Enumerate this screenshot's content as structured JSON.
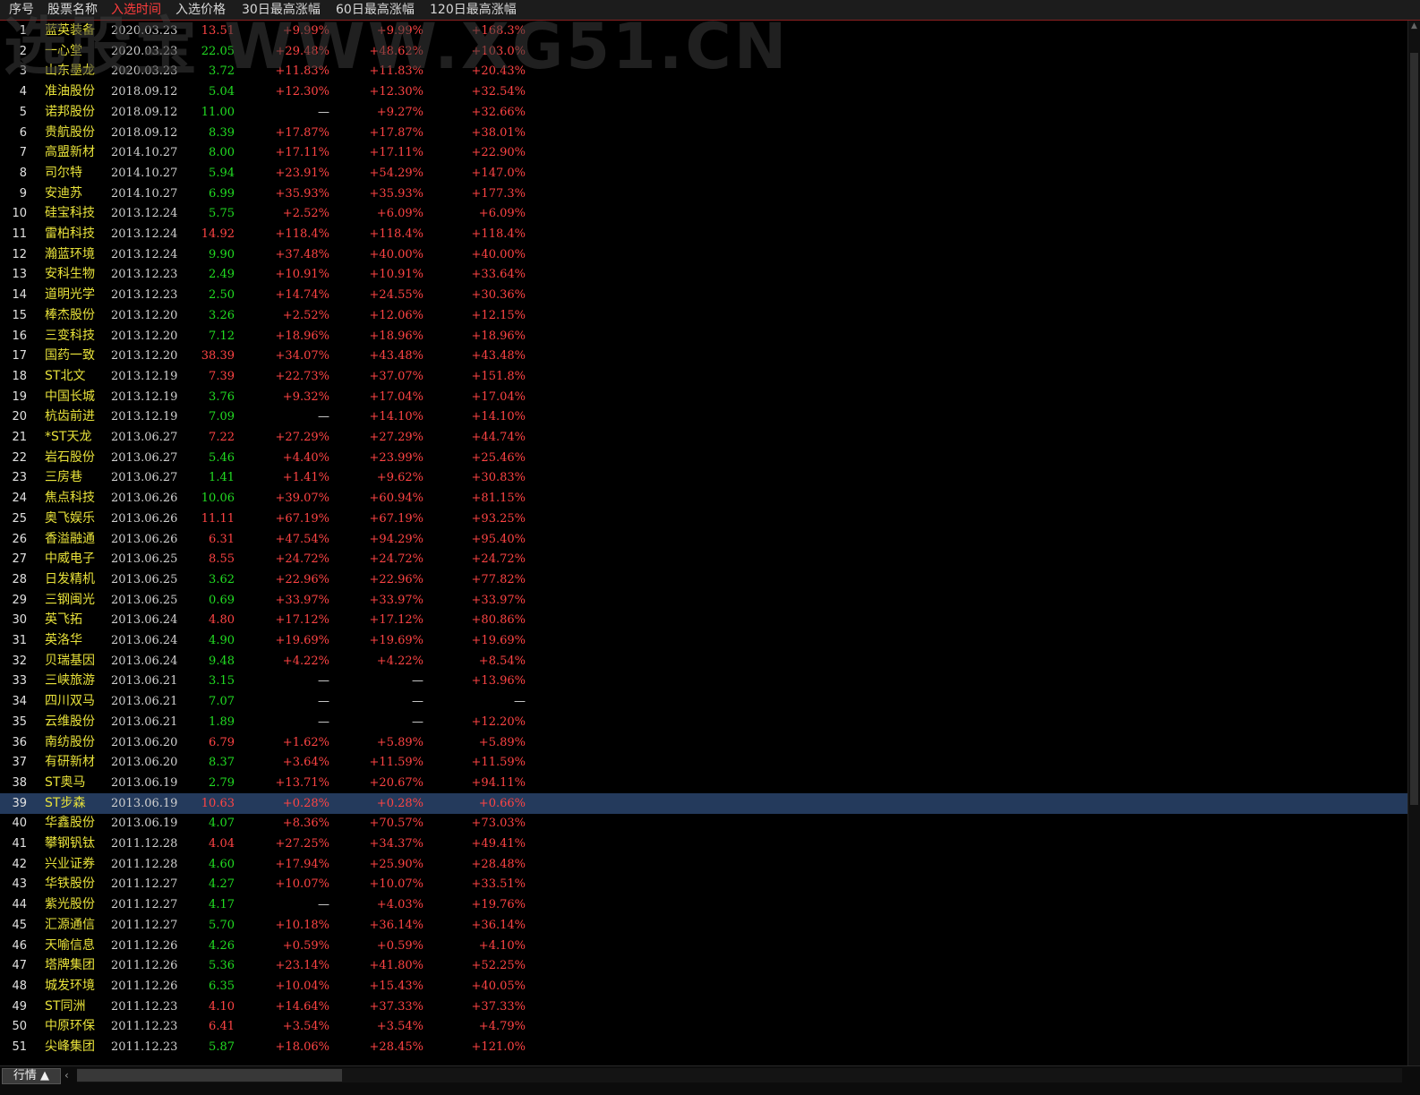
{
  "watermark": "选股宝 WWW.XG51.CN",
  "columns": [
    "序号",
    "股票名称",
    "入选时间",
    "入选价格",
    "30日最高涨幅",
    "60日最高涨幅",
    "120日最高涨幅"
  ],
  "rows": [
    {
      "idx": "1",
      "name": "蓝英装备",
      "date": "2020.03.23",
      "price": "13.51",
      "pdir": "up",
      "g30": "+9.99%",
      "g60": "+9.99%",
      "g120": "+168.3%"
    },
    {
      "idx": "2",
      "name": "一心堂",
      "date": "2020.03.23",
      "price": "22.05",
      "pdir": "down",
      "g30": "+29.48%",
      "g60": "+48.62%",
      "g120": "+103.0%"
    },
    {
      "idx": "3",
      "name": "山东墨龙",
      "date": "2020.03.23",
      "price": "3.72",
      "pdir": "down",
      "g30": "+11.83%",
      "g60": "+11.83%",
      "g120": "+20.43%"
    },
    {
      "idx": "4",
      "name": "准油股份",
      "date": "2018.09.12",
      "price": "5.04",
      "pdir": "down",
      "g30": "+12.30%",
      "g60": "+12.30%",
      "g120": "+32.54%"
    },
    {
      "idx": "5",
      "name": "诺邦股份",
      "date": "2018.09.12",
      "price": "11.00",
      "pdir": "down",
      "g30": "—",
      "g60": "+9.27%",
      "g120": "+32.66%"
    },
    {
      "idx": "6",
      "name": "贵航股份",
      "date": "2018.09.12",
      "price": "8.39",
      "pdir": "down",
      "g30": "+17.87%",
      "g60": "+17.87%",
      "g120": "+38.01%"
    },
    {
      "idx": "7",
      "name": "高盟新材",
      "date": "2014.10.27",
      "price": "8.00",
      "pdir": "down",
      "g30": "+17.11%",
      "g60": "+17.11%",
      "g120": "+22.90%"
    },
    {
      "idx": "8",
      "name": "司尔特",
      "date": "2014.10.27",
      "price": "5.94",
      "pdir": "down",
      "g30": "+23.91%",
      "g60": "+54.29%",
      "g120": "+147.0%"
    },
    {
      "idx": "9",
      "name": "安迪苏",
      "date": "2014.10.27",
      "price": "6.99",
      "pdir": "down",
      "g30": "+35.93%",
      "g60": "+35.93%",
      "g120": "+177.3%"
    },
    {
      "idx": "10",
      "name": "硅宝科技",
      "date": "2013.12.24",
      "price": "5.75",
      "pdir": "down",
      "g30": "+2.52%",
      "g60": "+6.09%",
      "g120": "+6.09%"
    },
    {
      "idx": "11",
      "name": "雷柏科技",
      "date": "2013.12.24",
      "price": "14.92",
      "pdir": "up",
      "g30": "+118.4%",
      "g60": "+118.4%",
      "g120": "+118.4%"
    },
    {
      "idx": "12",
      "name": "瀚蓝环境",
      "date": "2013.12.24",
      "price": "9.90",
      "pdir": "down",
      "g30": "+37.48%",
      "g60": "+40.00%",
      "g120": "+40.00%"
    },
    {
      "idx": "13",
      "name": "安科生物",
      "date": "2013.12.23",
      "price": "2.49",
      "pdir": "down",
      "g30": "+10.91%",
      "g60": "+10.91%",
      "g120": "+33.64%"
    },
    {
      "idx": "14",
      "name": "道明光学",
      "date": "2013.12.23",
      "price": "2.50",
      "pdir": "down",
      "g30": "+14.74%",
      "g60": "+24.55%",
      "g120": "+30.36%"
    },
    {
      "idx": "15",
      "name": "棒杰股份",
      "date": "2013.12.20",
      "price": "3.26",
      "pdir": "down",
      "g30": "+2.52%",
      "g60": "+12.06%",
      "g120": "+12.15%"
    },
    {
      "idx": "16",
      "name": "三变科技",
      "date": "2013.12.20",
      "price": "7.12",
      "pdir": "down",
      "g30": "+18.96%",
      "g60": "+18.96%",
      "g120": "+18.96%"
    },
    {
      "idx": "17",
      "name": "国药一致",
      "date": "2013.12.20",
      "price": "38.39",
      "pdir": "up",
      "g30": "+34.07%",
      "g60": "+43.48%",
      "g120": "+43.48%"
    },
    {
      "idx": "18",
      "name": "ST北文",
      "date": "2013.12.19",
      "price": "7.39",
      "pdir": "up",
      "g30": "+22.73%",
      "g60": "+37.07%",
      "g120": "+151.8%"
    },
    {
      "idx": "19",
      "name": "中国长城",
      "date": "2013.12.19",
      "price": "3.76",
      "pdir": "down",
      "g30": "+9.32%",
      "g60": "+17.04%",
      "g120": "+17.04%"
    },
    {
      "idx": "20",
      "name": "杭齿前进",
      "date": "2013.12.19",
      "price": "7.09",
      "pdir": "down",
      "g30": "—",
      "g60": "+14.10%",
      "g120": "+14.10%"
    },
    {
      "idx": "21",
      "name": "*ST天龙",
      "date": "2013.06.27",
      "price": "7.22",
      "pdir": "up",
      "g30": "+27.29%",
      "g60": "+27.29%",
      "g120": "+44.74%"
    },
    {
      "idx": "22",
      "name": "岩石股份",
      "date": "2013.06.27",
      "price": "5.46",
      "pdir": "down",
      "g30": "+4.40%",
      "g60": "+23.99%",
      "g120": "+25.46%"
    },
    {
      "idx": "23",
      "name": "三房巷",
      "date": "2013.06.27",
      "price": "1.41",
      "pdir": "down",
      "g30": "+1.41%",
      "g60": "+9.62%",
      "g120": "+30.83%"
    },
    {
      "idx": "24",
      "name": "焦点科技",
      "date": "2013.06.26",
      "price": "10.06",
      "pdir": "down",
      "g30": "+39.07%",
      "g60": "+60.94%",
      "g120": "+81.15%"
    },
    {
      "idx": "25",
      "name": "奥飞娱乐",
      "date": "2013.06.26",
      "price": "11.11",
      "pdir": "up",
      "g30": "+67.19%",
      "g60": "+67.19%",
      "g120": "+93.25%"
    },
    {
      "idx": "26",
      "name": "香溢融通",
      "date": "2013.06.26",
      "price": "6.31",
      "pdir": "up",
      "g30": "+47.54%",
      "g60": "+94.29%",
      "g120": "+95.40%"
    },
    {
      "idx": "27",
      "name": "中威电子",
      "date": "2013.06.25",
      "price": "8.55",
      "pdir": "up",
      "g30": "+24.72%",
      "g60": "+24.72%",
      "g120": "+24.72%"
    },
    {
      "idx": "28",
      "name": "日发精机",
      "date": "2013.06.25",
      "price": "3.62",
      "pdir": "down",
      "g30": "+22.96%",
      "g60": "+22.96%",
      "g120": "+77.82%"
    },
    {
      "idx": "29",
      "name": "三钢闽光",
      "date": "2013.06.25",
      "price": "0.69",
      "pdir": "down",
      "g30": "+33.97%",
      "g60": "+33.97%",
      "g120": "+33.97%"
    },
    {
      "idx": "30",
      "name": "英飞拓",
      "date": "2013.06.24",
      "price": "4.80",
      "pdir": "up",
      "g30": "+17.12%",
      "g60": "+17.12%",
      "g120": "+80.86%"
    },
    {
      "idx": "31",
      "name": "英洛华",
      "date": "2013.06.24",
      "price": "4.90",
      "pdir": "down",
      "g30": "+19.69%",
      "g60": "+19.69%",
      "g120": "+19.69%"
    },
    {
      "idx": "32",
      "name": "贝瑞基因",
      "date": "2013.06.24",
      "price": "9.48",
      "pdir": "down",
      "g30": "+4.22%",
      "g60": "+4.22%",
      "g120": "+8.54%"
    },
    {
      "idx": "33",
      "name": "三峡旅游",
      "date": "2013.06.21",
      "price": "3.15",
      "pdir": "down",
      "g30": "—",
      "g60": "—",
      "g120": "+13.96%"
    },
    {
      "idx": "34",
      "name": "四川双马",
      "date": "2013.06.21",
      "price": "7.07",
      "pdir": "down",
      "g30": "—",
      "g60": "—",
      "g120": "—"
    },
    {
      "idx": "35",
      "name": "云维股份",
      "date": "2013.06.21",
      "price": "1.89",
      "pdir": "down",
      "g30": "—",
      "g60": "—",
      "g120": "+12.20%"
    },
    {
      "idx": "36",
      "name": "南纺股份",
      "date": "2013.06.20",
      "price": "6.79",
      "pdir": "up",
      "g30": "+1.62%",
      "g60": "+5.89%",
      "g120": "+5.89%"
    },
    {
      "idx": "37",
      "name": "有研新材",
      "date": "2013.06.20",
      "price": "8.37",
      "pdir": "down",
      "g30": "+3.64%",
      "g60": "+11.59%",
      "g120": "+11.59%"
    },
    {
      "idx": "38",
      "name": "ST奥马",
      "date": "2013.06.19",
      "price": "2.79",
      "pdir": "down",
      "g30": "+13.71%",
      "g60": "+20.67%",
      "g120": "+94.11%"
    },
    {
      "idx": "39",
      "name": "ST步森",
      "date": "2013.06.19",
      "price": "10.63",
      "pdir": "up",
      "g30": "+0.28%",
      "g60": "+0.28%",
      "g120": "+0.66%"
    },
    {
      "idx": "40",
      "name": "华鑫股份",
      "date": "2013.06.19",
      "price": "4.07",
      "pdir": "down",
      "g30": "+8.36%",
      "g60": "+70.57%",
      "g120": "+73.03%"
    },
    {
      "idx": "41",
      "name": "攀钢钒钛",
      "date": "2011.12.28",
      "price": "4.04",
      "pdir": "up",
      "g30": "+27.25%",
      "g60": "+34.37%",
      "g120": "+49.41%"
    },
    {
      "idx": "42",
      "name": "兴业证券",
      "date": "2011.12.28",
      "price": "4.60",
      "pdir": "down",
      "g30": "+17.94%",
      "g60": "+25.90%",
      "g120": "+28.48%"
    },
    {
      "idx": "43",
      "name": "华铁股份",
      "date": "2011.12.27",
      "price": "4.27",
      "pdir": "down",
      "g30": "+10.07%",
      "g60": "+10.07%",
      "g120": "+33.51%"
    },
    {
      "idx": "44",
      "name": "紫光股份",
      "date": "2011.12.27",
      "price": "4.17",
      "pdir": "down",
      "g30": "—",
      "g60": "+4.03%",
      "g120": "+19.76%"
    },
    {
      "idx": "45",
      "name": "汇源通信",
      "date": "2011.12.27",
      "price": "5.70",
      "pdir": "down",
      "g30": "+10.18%",
      "g60": "+36.14%",
      "g120": "+36.14%"
    },
    {
      "idx": "46",
      "name": "天喻信息",
      "date": "2011.12.26",
      "price": "4.26",
      "pdir": "down",
      "g30": "+0.59%",
      "g60": "+0.59%",
      "g120": "+4.10%"
    },
    {
      "idx": "47",
      "name": "塔牌集团",
      "date": "2011.12.26",
      "price": "5.36",
      "pdir": "down",
      "g30": "+23.14%",
      "g60": "+41.80%",
      "g120": "+52.25%"
    },
    {
      "idx": "48",
      "name": "城发环境",
      "date": "2011.12.26",
      "price": "6.35",
      "pdir": "down",
      "g30": "+10.04%",
      "g60": "+15.43%",
      "g120": "+40.05%"
    },
    {
      "idx": "49",
      "name": "ST同洲",
      "date": "2011.12.23",
      "price": "4.10",
      "pdir": "up",
      "g30": "+14.64%",
      "g60": "+37.33%",
      "g120": "+37.33%"
    },
    {
      "idx": "50",
      "name": "中原环保",
      "date": "2011.12.23",
      "price": "6.41",
      "pdir": "up",
      "g30": "+3.54%",
      "g60": "+3.54%",
      "g120": "+4.79%"
    },
    {
      "idx": "51",
      "name": "尖峰集团",
      "date": "2011.12.23",
      "price": "5.87",
      "pdir": "down",
      "g30": "+18.06%",
      "g60": "+28.45%",
      "g120": "+121.0%"
    }
  ],
  "selected_row": "39",
  "bottom": {
    "tab_label": "行情 ▲",
    "scroll_left": "‹"
  },
  "colors": {
    "up": "#ff4444",
    "down": "#22dd22",
    "name": "#e8e23a",
    "header_active": "#ff3c3c",
    "selected_bg": "#243a5c"
  }
}
